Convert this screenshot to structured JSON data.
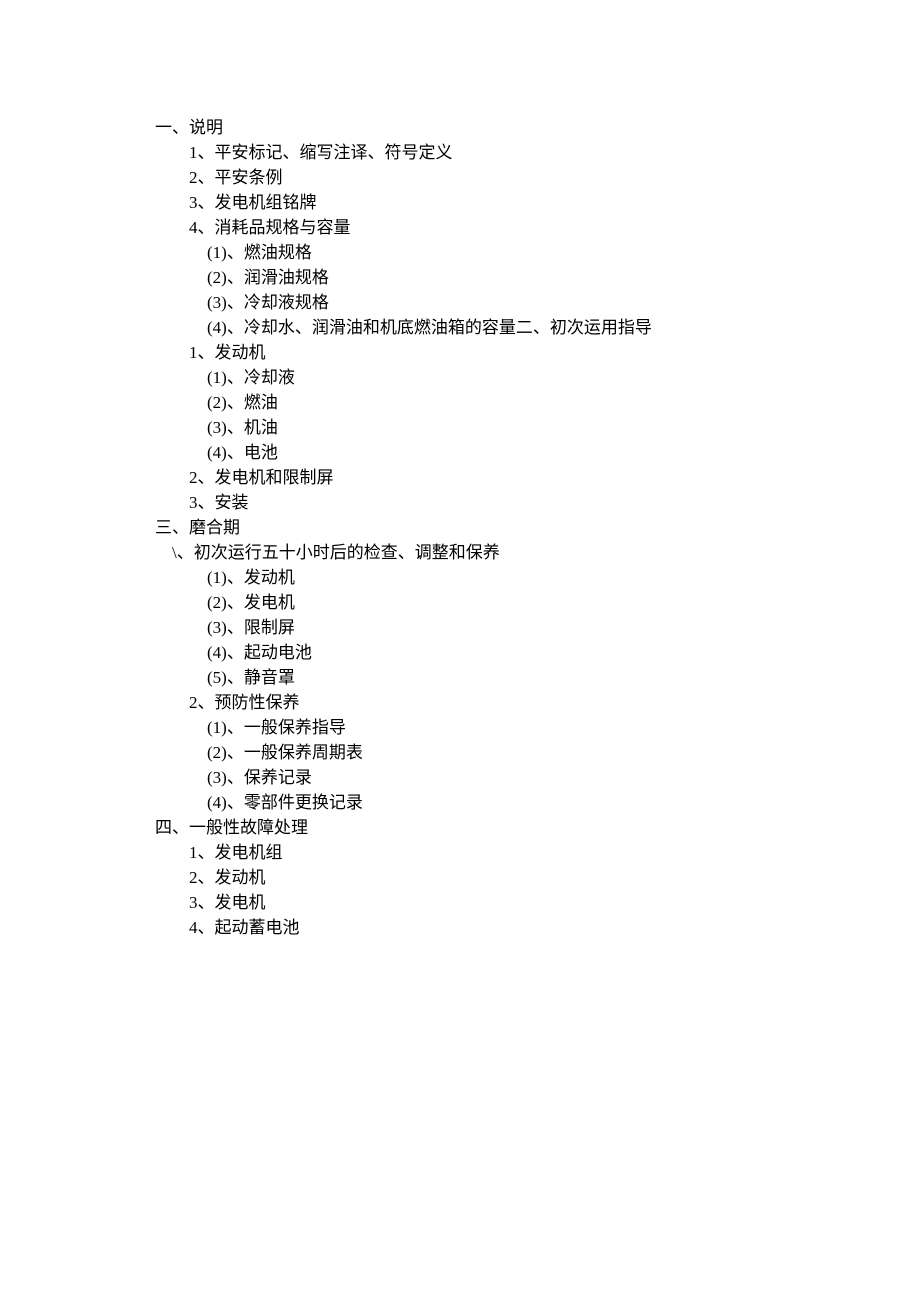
{
  "toc": [
    {
      "indent": "indent-0",
      "text": "一、说明"
    },
    {
      "indent": "indent-1",
      "text": "1、平安标记、缩写注译、符号定义"
    },
    {
      "indent": "indent-1",
      "text": "2、平安条例"
    },
    {
      "indent": "indent-1",
      "text": "3、发电机组铭牌"
    },
    {
      "indent": "indent-1",
      "text": "4、消耗品规格与容量"
    },
    {
      "indent": "indent-2",
      "text": "(1)、燃油规格"
    },
    {
      "indent": "indent-2",
      "text": "(2)、润滑油规格"
    },
    {
      "indent": "indent-2",
      "text": "(3)、冷却液规格"
    },
    {
      "indent": "indent-2",
      "text": "(4)、冷却水、润滑油和机底燃油箱的容量二、初次运用指导"
    },
    {
      "indent": "indent-1",
      "text": "1、发动机"
    },
    {
      "indent": "indent-2",
      "text": "(1)、冷却液"
    },
    {
      "indent": "indent-2",
      "text": "(2)、燃油"
    },
    {
      "indent": "indent-2",
      "text": "(3)、机油"
    },
    {
      "indent": "indent-2",
      "text": "(4)、电池"
    },
    {
      "indent": "indent-1",
      "text": "2、发电机和限制屏"
    },
    {
      "indent": "indent-1",
      "text": "3、安装"
    },
    {
      "indent": "indent-0",
      "text": "三、磨合期"
    },
    {
      "indent": "indent-backslash",
      "text": "\\、初次运行五十小时后的检查、调整和保养"
    },
    {
      "indent": "indent-2",
      "text": "(1)、发动机"
    },
    {
      "indent": "indent-2",
      "text": "(2)、发电机"
    },
    {
      "indent": "indent-2",
      "text": "(3)、限制屏"
    },
    {
      "indent": "indent-2",
      "text": "(4)、起动电池"
    },
    {
      "indent": "indent-2",
      "text": "(5)、静音罩"
    },
    {
      "indent": "indent-1",
      "text": "2、预防性保养"
    },
    {
      "indent": "indent-2",
      "text": "(1)、一般保养指导"
    },
    {
      "indent": "indent-2",
      "text": "(2)、一般保养周期表"
    },
    {
      "indent": "indent-2",
      "text": "(3)、保养记录"
    },
    {
      "indent": "indent-2",
      "text": "(4)、零部件更换记录"
    },
    {
      "indent": "indent-0",
      "text": "四、一般性故障处理"
    },
    {
      "indent": "indent-1",
      "text": "1、发电机组"
    },
    {
      "indent": "indent-1",
      "text": "2、发动机"
    },
    {
      "indent": "indent-1",
      "text": "3、发电机"
    },
    {
      "indent": "indent-1",
      "text": "4、起动蓄电池"
    }
  ]
}
